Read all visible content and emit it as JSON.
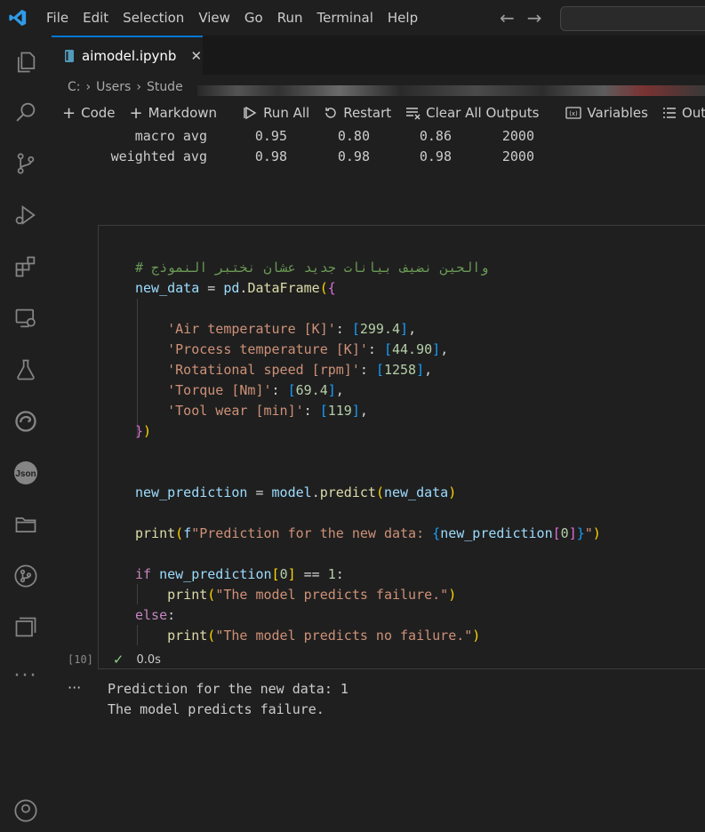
{
  "menu": [
    "File",
    "Edit",
    "Selection",
    "View",
    "Go",
    "Run",
    "Terminal",
    "Help"
  ],
  "tab": {
    "label": "aimodel.ipynb",
    "close": "✕"
  },
  "breadcrumb": {
    "part1": "C:",
    "part2": "Users",
    "part3": "Stude"
  },
  "toolbar": {
    "code": "Code",
    "markdown": "Markdown",
    "run_all": "Run All",
    "restart": "Restart",
    "clear_outputs": "Clear All Outputs",
    "variables": "Variables",
    "outline": "Outli"
  },
  "report": [
    {
      "label": "macro avg",
      "precision": "0.95",
      "recall": "0.80",
      "f1": "0.86",
      "support": "2000"
    },
    {
      "label": "weighted avg",
      "precision": "0.98",
      "recall": "0.98",
      "f1": "0.98",
      "support": "2000"
    }
  ],
  "code": {
    "comment": "# والحين نضيف بيانات جديد عشان نختبر النموذج",
    "var_new_data": "new_data",
    "pd": "pd",
    "dataframe": "DataFrame",
    "keys": [
      "'Air temperature [K]'",
      "'Process temperature [K]'",
      "'Rotational speed [rpm]'",
      "'Torque [Nm]'",
      "'Tool wear [min]'"
    ],
    "values": [
      "299.4",
      "44.90",
      "1258",
      "69.4",
      "119"
    ],
    "var_new_prediction": "new_prediction",
    "model": "model",
    "predict": "predict",
    "print": "print",
    "fstring_text": "\"Prediction for the new data: ",
    "fstring_end": "\"",
    "kw_if": "if",
    "kw_else": "else",
    "zero": "0",
    "one": "1",
    "str_failure": "\"The model predicts failure.\"",
    "str_no_failure": "\"The model predicts no failure.\""
  },
  "cell_status": {
    "exec_count": "[10]",
    "duration": "0.0s"
  },
  "output": [
    "Prediction for the new data: 1",
    "The model predicts failure."
  ],
  "colors": {
    "accent": "#0078d4",
    "success": "#89d185",
    "background": "#1f1f1f"
  }
}
